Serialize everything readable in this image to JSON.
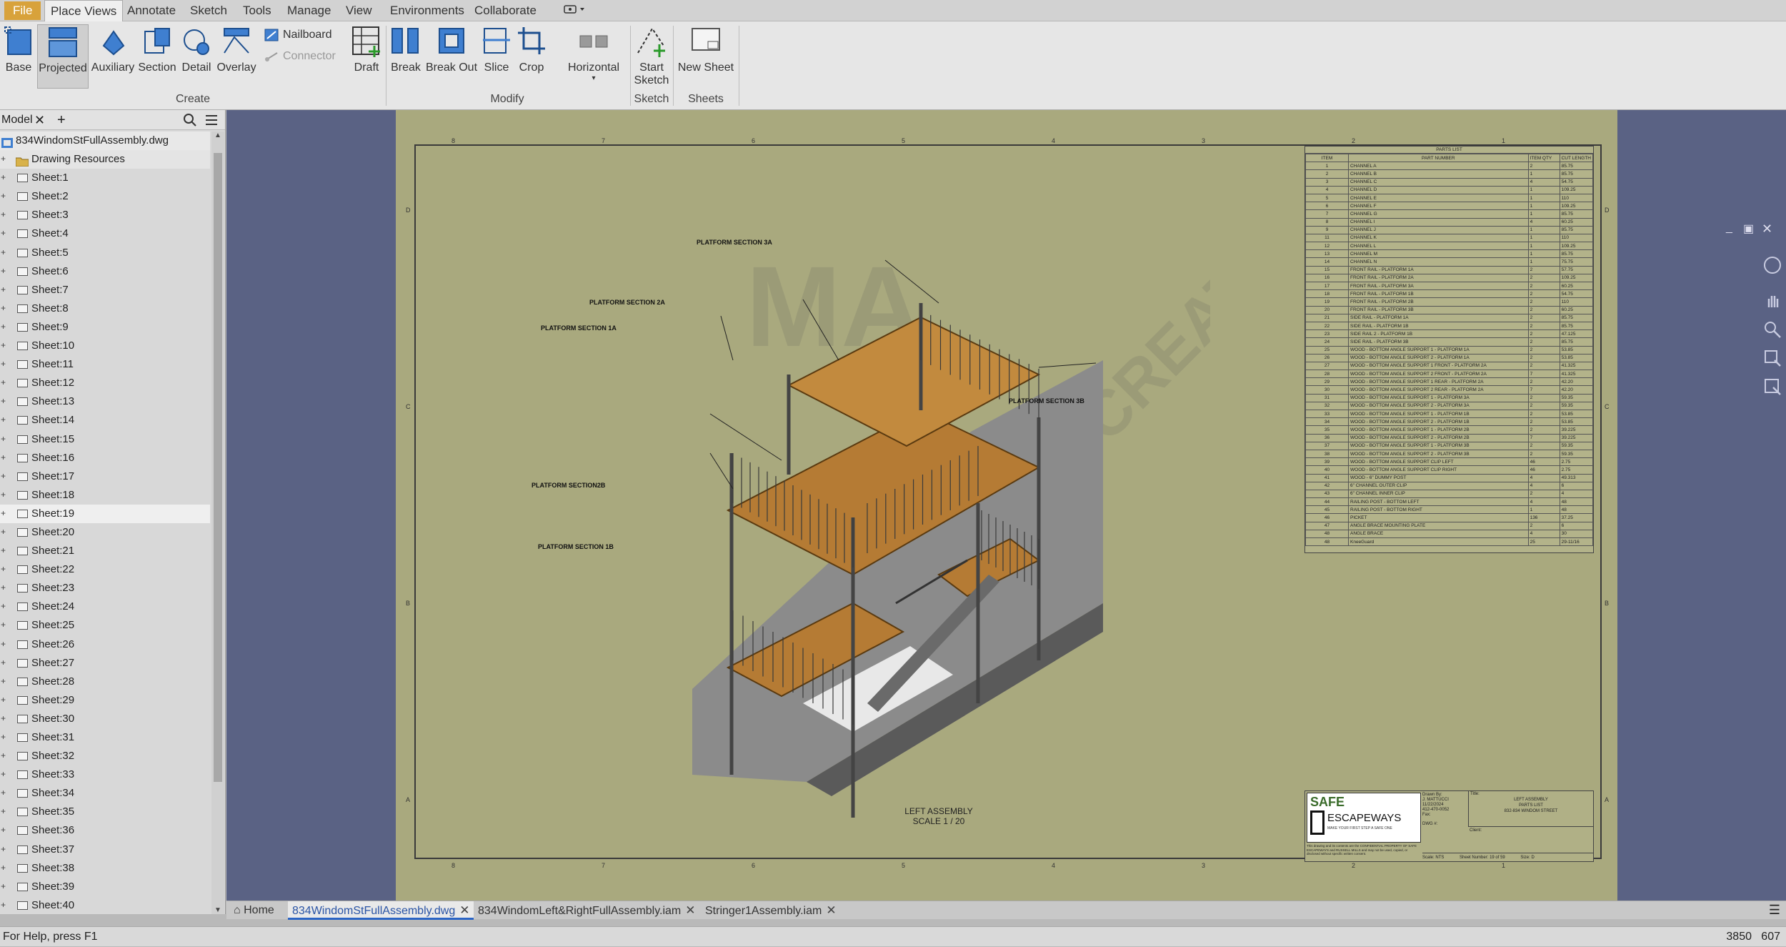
{
  "menu": {
    "items": [
      "File",
      "Place Views",
      "Annotate",
      "Sketch",
      "Tools",
      "Manage",
      "View",
      "Environments",
      "Collaborate"
    ],
    "active": "Place Views"
  },
  "ribbon": {
    "create_buttons": [
      "Base",
      "Projected",
      "Auxiliary",
      "Section",
      "Detail",
      "Overlay"
    ],
    "create_small": [
      "Nailboard",
      "Connector"
    ],
    "create_label": "Create",
    "modify_buttons": [
      "Draft",
      "Break",
      "Break Out",
      "Slice",
      "Crop"
    ],
    "horizontal": "Horizontal",
    "modify_label": "Modify",
    "sketch_button_line1": "Start",
    "sketch_button_line2": "Sketch",
    "sketch_label": "Sketch",
    "sheets_button": "New Sheet",
    "sheets_label": "Sheets"
  },
  "browser": {
    "tab": "Model",
    "file": "834WindomStFullAssembly.dwg",
    "resources": "Drawing Resources",
    "sheets": [
      "Sheet:1",
      "Sheet:2",
      "Sheet:3",
      "Sheet:4",
      "Sheet:5",
      "Sheet:6",
      "Sheet:7",
      "Sheet:8",
      "Sheet:9",
      "Sheet:10",
      "Sheet:11",
      "Sheet:12",
      "Sheet:13",
      "Sheet:14",
      "Sheet:15",
      "Sheet:16",
      "Sheet:17",
      "Sheet:18",
      "Sheet:19",
      "Sheet:20",
      "Sheet:21",
      "Sheet:22",
      "Sheet:23",
      "Sheet:24",
      "Sheet:25",
      "Sheet:26",
      "Sheet:27",
      "Sheet:28",
      "Sheet:29",
      "Sheet:30",
      "Sheet:31",
      "Sheet:32",
      "Sheet:33",
      "Sheet:34",
      "Sheet:35",
      "Sheet:36",
      "Sheet:37",
      "Sheet:38",
      "Sheet:39",
      "Sheet:40"
    ],
    "selected_sheet": "Sheet:19"
  },
  "drawing": {
    "zone_numbers_top": [
      "8",
      "7",
      "6",
      "5",
      "4",
      "3",
      "2",
      "1"
    ],
    "zone_letters": [
      "D",
      "C",
      "B",
      "A"
    ],
    "callouts": [
      "PLATFORM SECTION 3A",
      "PLATFORM SECTION 2A",
      "PLATFORM SECTION 1A",
      "PLATFORM SECTION 3B",
      "PLATFORM SECTION2B",
      "PLATFORM SECTION 1B"
    ],
    "view_label_line1": "LEFT ASSEMBLY",
    "view_label_line2": "SCALE 1 / 20",
    "parts_list": {
      "title": "PARTS LIST",
      "headers": [
        "ITEM",
        "PART NUMBER",
        "ITEM QTY",
        "CUT LENGTH"
      ],
      "rows": [
        [
          "1",
          "CHANNEL A",
          "2",
          "85.75"
        ],
        [
          "2",
          "CHANNEL B",
          "1",
          "85.75"
        ],
        [
          "3",
          "CHANNEL C",
          "4",
          "54.75"
        ],
        [
          "4",
          "CHANNEL D",
          "1",
          "109.25"
        ],
        [
          "5",
          "CHANNEL E",
          "1",
          "110"
        ],
        [
          "6",
          "CHANNEL F",
          "1",
          "109.25"
        ],
        [
          "7",
          "CHANNEL G",
          "1",
          "85.75"
        ],
        [
          "8",
          "CHANNEL I",
          "4",
          "60.25"
        ],
        [
          "9",
          "CHANNEL J",
          "1",
          "85.75"
        ],
        [
          "11",
          "CHANNEL K",
          "1",
          "110"
        ],
        [
          "12",
          "CHANNEL L",
          "1",
          "109.25"
        ],
        [
          "13",
          "CHANNEL M",
          "1",
          "85.75"
        ],
        [
          "14",
          "CHANNEL N",
          "1",
          "75.75"
        ],
        [
          "15",
          "FRONT RAIL - PLATFORM 1A",
          "2",
          "57.75"
        ],
        [
          "16",
          "FRONT RAIL - PLATFORM 2A",
          "2",
          "109.25"
        ],
        [
          "17",
          "FRONT RAIL - PLATFORM 3A",
          "2",
          "60.25"
        ],
        [
          "18",
          "FRONT RAIL - PLATFORM 1B",
          "2",
          "54.75"
        ],
        [
          "19",
          "FRONT RAIL - PLATFORM 2B",
          "2",
          "110"
        ],
        [
          "20",
          "FRONT RAIL - PLATFORM 3B",
          "2",
          "60.25"
        ],
        [
          "21",
          "SIDE RAIL - PLATFORM 1A",
          "2",
          "85.75"
        ],
        [
          "22",
          "SIDE RAIL - PLATFORM 1B",
          "2",
          "85.75"
        ],
        [
          "23",
          "SIDE RAIL 2 - PLATFORM 1B",
          "2",
          "47.125"
        ],
        [
          "24",
          "SIDE RAIL - PLATFORM 3B",
          "2",
          "85.75"
        ],
        [
          "25",
          "WOOD - BOTTOM ANGLE SUPPORT 1 - PLATFORM 1A",
          "2",
          "53.85"
        ],
        [
          "26",
          "WOOD - BOTTOM ANGLE SUPPORT 2 - PLATFORM 1A",
          "2",
          "53.85"
        ],
        [
          "27",
          "WOOD - BOTTOM ANGLE SUPPORT 1 FRONT - PLATFORM 2A",
          "2",
          "41.325"
        ],
        [
          "28",
          "WOOD - BOTTOM ANGLE SUPPORT 2 FRONT - PLATFORM 2A",
          "7",
          "41.325"
        ],
        [
          "29",
          "WOOD - BOTTOM ANGLE SUPPORT 1 REAR - PLATFORM 2A",
          "2",
          "42.20"
        ],
        [
          "30",
          "WOOD - BOTTOM ANGLE SUPPORT 2 REAR - PLATFORM 2A",
          "7",
          "42.20"
        ],
        [
          "31",
          "WOOD - BOTTOM ANGLE SUPPORT 1 - PLATFORM 3A",
          "2",
          "59.35"
        ],
        [
          "32",
          "WOOD - BOTTOM ANGLE SUPPORT 2 - PLATFORM 3A",
          "2",
          "59.35"
        ],
        [
          "33",
          "WOOD - BOTTOM ANGLE SUPPORT 1 - PLATFORM 1B",
          "2",
          "53.85"
        ],
        [
          "34",
          "WOOD - BOTTOM ANGLE SUPPORT 2 - PLATFORM 1B",
          "2",
          "53.85"
        ],
        [
          "35",
          "WOOD - BOTTOM ANGLE SUPPORT 1 - PLATFORM 2B",
          "2",
          "39.225"
        ],
        [
          "36",
          "WOOD - BOTTOM ANGLE SUPPORT 2 - PLATFORM 2B",
          "7",
          "39.225"
        ],
        [
          "37",
          "WOOD - BOTTOM ANGLE SUPPORT 1 - PLATFORM 3B",
          "2",
          "59.35"
        ],
        [
          "38",
          "WOOD - BOTTOM ANGLE SUPPORT 2 - PLATFORM 3B",
          "2",
          "59.35"
        ],
        [
          "39",
          "WOOD - BOTTOM ANGLE SUPPORT CLIP LEFT",
          "46",
          "2.75"
        ],
        [
          "40",
          "WOOD - BOTTOM ANGLE SUPPORT CLIP RIGHT",
          "46",
          "2.75"
        ],
        [
          "41",
          "WOOD - 6\" DUMMY POST",
          "4",
          "49.313"
        ],
        [
          "42",
          "6\" CHANNEL OUTER CLIP",
          "4",
          "6"
        ],
        [
          "43",
          "6\" CHANNEL INNER CLIP",
          "2",
          "4"
        ],
        [
          "44",
          "RAILING POST - BOTTOM LEFT",
          "4",
          "48"
        ],
        [
          "45",
          "RAILING POST - BOTTOM RIGHT",
          "1",
          "48"
        ],
        [
          "46",
          "PICKET",
          "136",
          "37.25"
        ],
        [
          "47",
          "ANGLE BRACE MOUNTING PLATE",
          "2",
          "6"
        ],
        [
          "48",
          "ANGLE BRACE",
          "4",
          "30"
        ],
        [
          "48",
          "KneeGuard",
          "25",
          "29-11/16"
        ]
      ]
    },
    "title_block": {
      "logo_line1": "SAFE",
      "logo_line2": "ESCAPEWAYS",
      "logo_tagline": "MAKE YOUR FIRST STEP A SAFE ONE",
      "drawn_by_label": "Drawn By:",
      "drawn_by": "J. MATTUCCI",
      "date": "11/22/2024",
      "phone": "412-470-0052",
      "fax_label": "Fax:",
      "dwg_label": "DWG #:",
      "title_label": "Title:",
      "title_line1": "LEFT ASSEMBLY",
      "title_line2": "PARTS LIST",
      "title_line3": "832-834 WINDOM STREET",
      "client_label": "Client:",
      "notice": "This drawing and its contents are the CONFIDENTIAL PROPERTY OF SAFE ESCAPEWAYS and RUSSELL MILLS and may not be used, copied, or disclosed without specific written consent.",
      "scale_label": "Scale:",
      "scale": "NTS",
      "sheet_number_label": "Sheet Number:",
      "sheet_number": "19 of 59",
      "size_label": "Size:",
      "size": "D"
    }
  },
  "doc_tabs": [
    "834WindomStFullAssembly.dwg",
    "834WindomLeft&RightFullAssembly.iam",
    "Stringer1Assembly.iam"
  ],
  "home_tab": "Home",
  "status": {
    "help": "For Help, press F1",
    "coord_x": "3850",
    "coord_y": "607"
  }
}
